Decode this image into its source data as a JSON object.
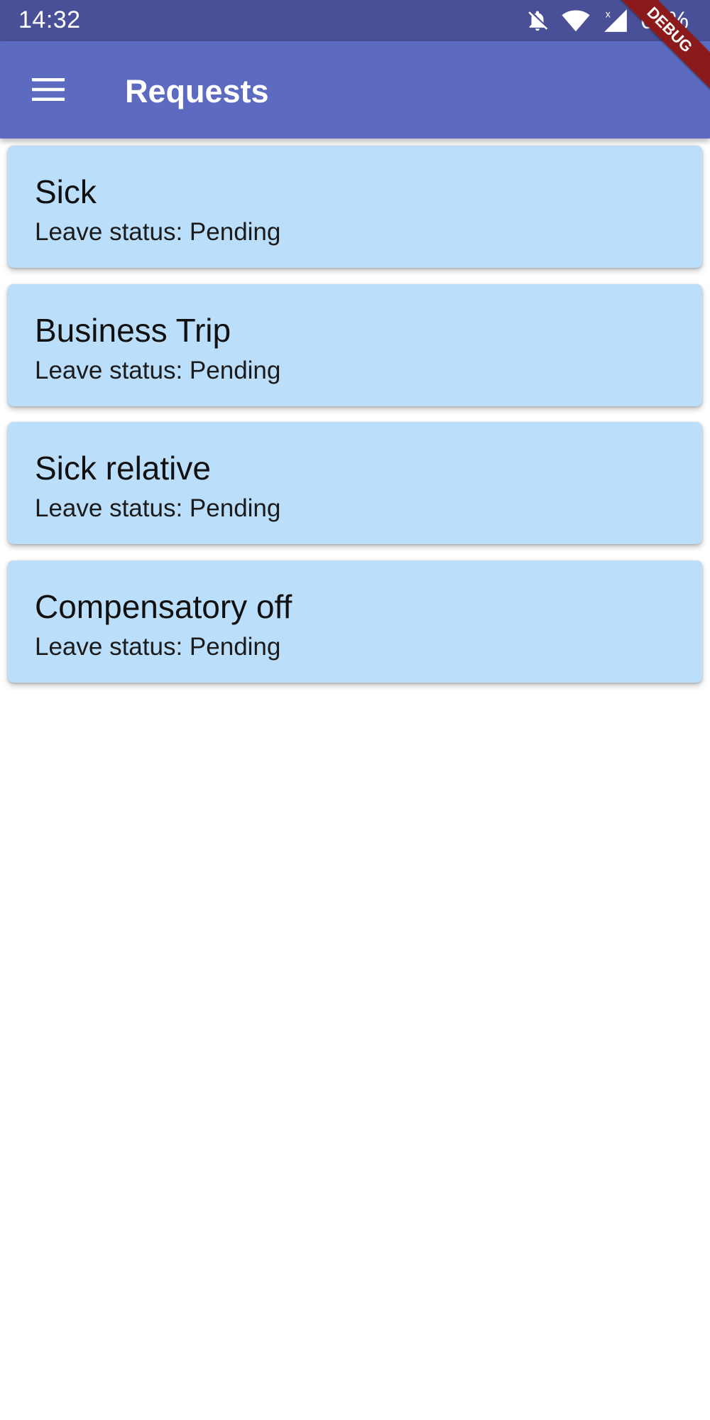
{
  "status_bar": {
    "time": "14:32",
    "battery": "67%",
    "icons": [
      "notifications-off-icon",
      "wifi-icon",
      "signal-icon",
      "battery-icon"
    ]
  },
  "app_bar": {
    "title": "Requests",
    "menu_icon": "menu-icon",
    "background": "#5c6bc0"
  },
  "debug_banner": "DEBUG",
  "requests": [
    {
      "title": "Sick",
      "status": "Leave status: Pending"
    },
    {
      "title": "Business Trip",
      "status": "Leave status: Pending"
    },
    {
      "title": "Sick relative",
      "status": "Leave status: Pending"
    },
    {
      "title": "Compensatory off",
      "status": "Leave status: Pending"
    }
  ],
  "colors": {
    "card_background": "#bbdefb",
    "status_bar": "#4a5097",
    "debug": "#8b1b1b"
  }
}
